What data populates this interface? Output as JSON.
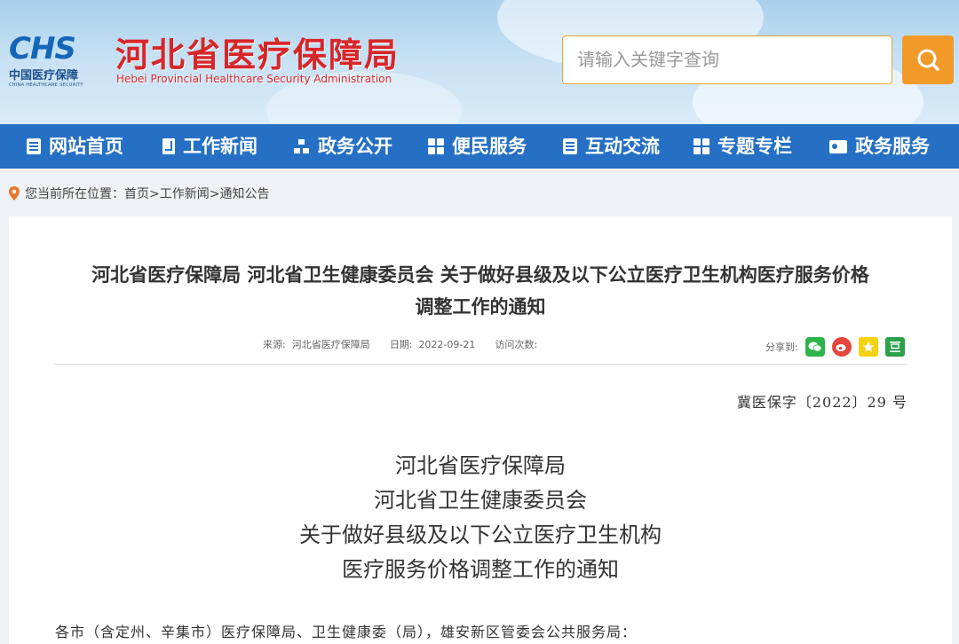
{
  "header": {
    "logo_text": "CHS",
    "logo_cn": "中国医疗保障",
    "logo_en": "CHINA HEALTHCARE SECURITY",
    "site_title": "河北省医疗保障局",
    "site_subtitle": "Hebei Provincial Healthcare Security Administration",
    "search_placeholder": "请输入关键字查询"
  },
  "nav": {
    "items": [
      {
        "label": "网站首页",
        "icon": "document-icon"
      },
      {
        "label": "工作新闻",
        "icon": "bookmark-icon"
      },
      {
        "label": "政务公开",
        "icon": "org-chart-icon"
      },
      {
        "label": "便民服务",
        "icon": "grid-icon"
      },
      {
        "label": "互动交流",
        "icon": "document-icon"
      },
      {
        "label": "专题专栏",
        "icon": "grid-icon"
      },
      {
        "label": "政务服务",
        "icon": "id-card-icon"
      }
    ]
  },
  "breadcrumb": {
    "prefix": "您当前所在位置：",
    "path": "首页>工作新闻>通知公告"
  },
  "article": {
    "title_line1": "河北省医疗保障局 河北省卫生健康委员会 关于做好县级及以下公立医疗卫生机构医疗服务价格",
    "title_line2": "调整工作的通知",
    "source_label": "来源:",
    "source_value": "河北省医疗保障局",
    "date_label": "日期:",
    "date_value": "2022-09-21",
    "views_label": "访问次数:",
    "share_label": "分享到:",
    "doc_number": "冀医保字〔2022〕29 号",
    "center_lines": [
      "河北省医疗保障局",
      "河北省卫生健康委员会",
      "关于做好县级及以下公立医疗卫生机构",
      "医疗服务价格调整工作的通知"
    ],
    "salutation": "各市（含定州、辛集市）医疗保障局、卫生健康委（局），雄安新区管委会公共服务局："
  },
  "colors": {
    "nav_bg": "#2570c4",
    "title_red": "#d7262a",
    "search_orange": "#f19a2a"
  }
}
